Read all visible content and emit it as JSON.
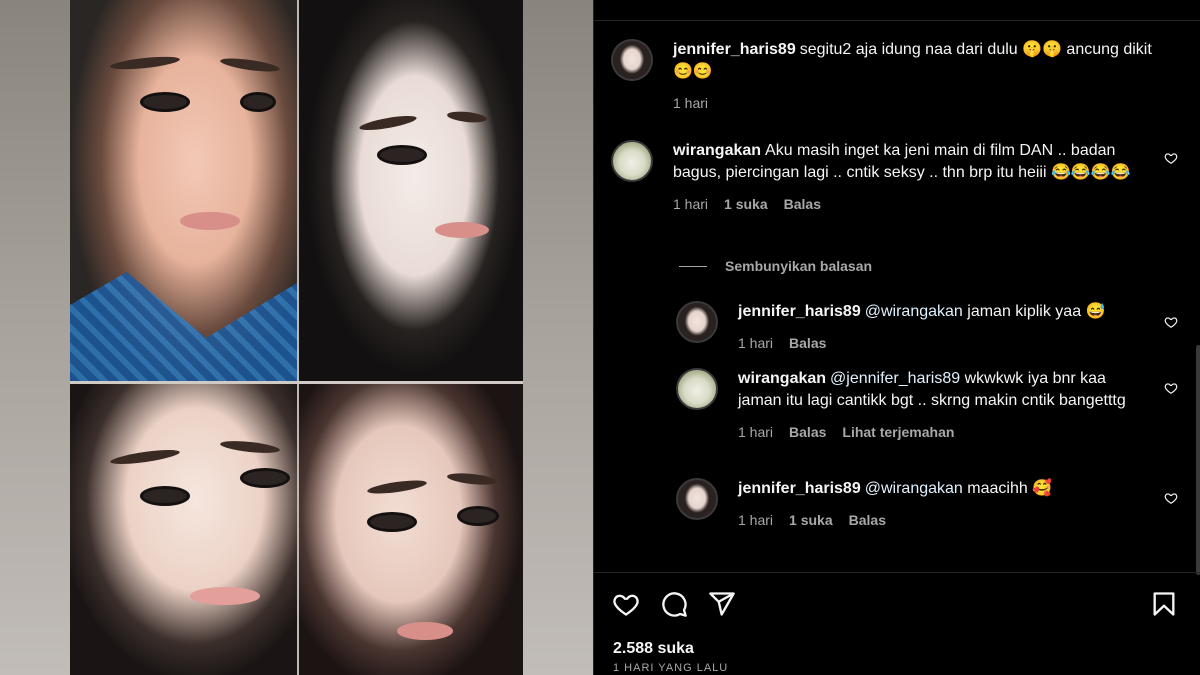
{
  "post": {
    "likes": "2.588 suka",
    "time_ago": "1 HARI YANG LALU"
  },
  "comments": [
    {
      "username": "jennifer_haris89",
      "text": "segitu2 aja idung naa dari dulu 🤫🤫 ancung dikit 😊😊",
      "time": "1 hari"
    },
    {
      "username": "wirangakan",
      "text": "Aku masih inget ka jeni main di film DAN .. badan bagus, piercingan lagi .. cntik seksy .. thn brp itu heiii 😂😂😂😂",
      "time": "1 hari",
      "likes": "1 suka",
      "reply": "Balas"
    }
  ],
  "hide_replies": "Sembunyikan balasan",
  "replies": [
    {
      "username": "jennifer_haris89",
      "mention": "@wirangakan",
      "text": "jaman kiplik yaa 😅",
      "time": "1 hari",
      "reply": "Balas"
    },
    {
      "username": "wirangakan",
      "mention": "@jennifer_haris89",
      "text": "wkwkwk iya bnr kaa jaman itu lagi cantikk bgt .. skrng makin cntik bangetttg",
      "time": "1 hari",
      "reply": "Balas",
      "translate": "Lihat terjemahan"
    },
    {
      "username": "jennifer_haris89",
      "mention": "@wirangakan",
      "text": "maacihh 🥰",
      "time": "1 hari",
      "likes": "1 suka",
      "reply": "Balas"
    }
  ],
  "icons": {
    "like": "heart-icon",
    "comment": "comment-icon",
    "share": "share-icon",
    "save": "bookmark-icon"
  }
}
